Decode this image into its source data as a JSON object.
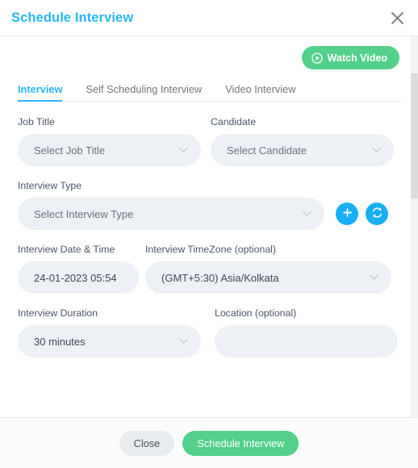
{
  "modal": {
    "title": "Schedule Interview",
    "close_icon": "close-icon"
  },
  "watch_video": {
    "label": "Watch Video",
    "icon": "play-circle-icon",
    "color": "#53d08a"
  },
  "tabs": [
    {
      "label": "Interview",
      "active": true
    },
    {
      "label": "Self Scheduling Interview",
      "active": false
    },
    {
      "label": "Video Interview",
      "active": false
    }
  ],
  "form": {
    "job_title": {
      "label": "Job Title",
      "value": "",
      "placeholder": "Select Job Title"
    },
    "candidate": {
      "label": "Candidate",
      "value": "",
      "placeholder": "Select Candidate"
    },
    "interview_type": {
      "label": "Interview Type",
      "value": "",
      "placeholder": "Select Interview Type",
      "add_icon": "plus-icon",
      "refresh_icon": "refresh-icon"
    },
    "interview_datetime": {
      "label": "Interview Date & Time",
      "value": "24-01-2023 05:54"
    },
    "interview_timezone": {
      "label": "Interview TimeZone (optional)",
      "value": "(GMT+5:30) Asia/Kolkata"
    },
    "interview_duration": {
      "label": "Interview Duration",
      "value": "30 minutes"
    },
    "location": {
      "label": "Location (optional)",
      "value": "",
      "placeholder": ""
    }
  },
  "footer": {
    "close_label": "Close",
    "submit_label": "Schedule Interview"
  },
  "colors": {
    "accent_blue": "#29b6f6",
    "accent_green": "#53d08a",
    "icon_blue": "#18aff5",
    "field_bg": "#edf0f4"
  }
}
